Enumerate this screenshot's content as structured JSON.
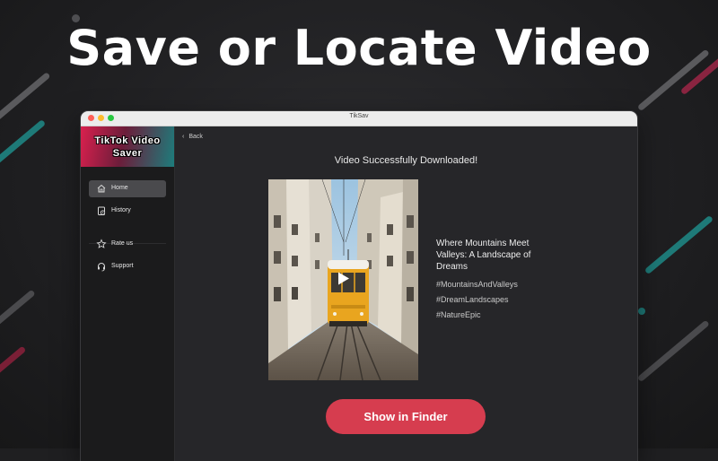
{
  "promo": {
    "headline": "Save or Locate Video"
  },
  "window": {
    "title": "TikSav"
  },
  "sidebar": {
    "brand": {
      "line1": "TikTok Video",
      "line2": "Saver"
    },
    "items": [
      {
        "label": "Home",
        "icon": "home-icon",
        "active": true
      },
      {
        "label": "History",
        "icon": "history-icon",
        "active": false
      },
      {
        "label": "Rate us",
        "icon": "star-icon",
        "active": false
      },
      {
        "label": "Support",
        "icon": "headset-icon",
        "active": false
      }
    ]
  },
  "content": {
    "back_label": "Back",
    "status": "Video Successfully Downloaded!",
    "video": {
      "title": "Where Mountains Meet Valleys: A Landscape of Dreams",
      "tags": [
        "#MountainsAndValleys",
        "#DreamLandscapes",
        "#NatureEpic"
      ]
    },
    "primary_button": "Show in Finder"
  },
  "colors": {
    "accent": "#d63d4f",
    "brand_pink": "#d9204e",
    "brand_teal": "#1d7d7c",
    "traffic_red": "#fe5f57",
    "traffic_yellow": "#febc2e",
    "traffic_green": "#28c840"
  }
}
